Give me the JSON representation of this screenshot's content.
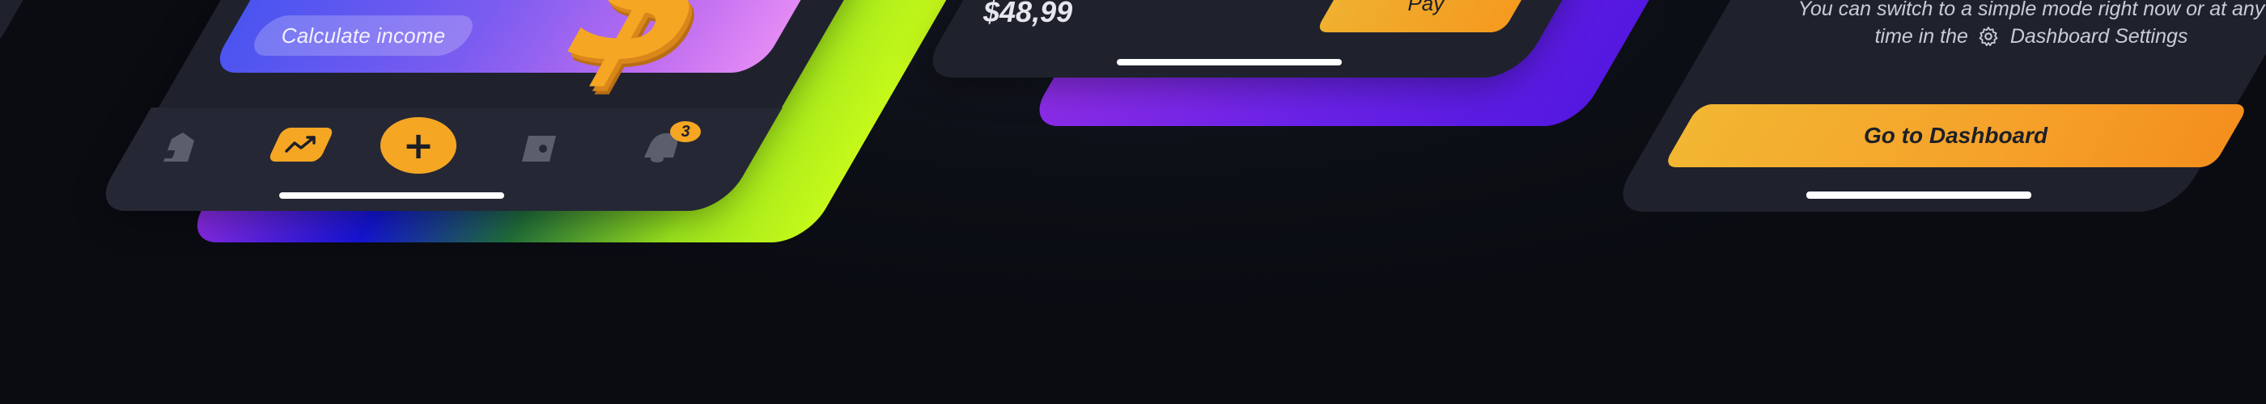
{
  "colors": {
    "background": "#0d0f16",
    "card": "#1f222d",
    "accent": "#f5a623",
    "purple": "#7b2be8",
    "lime": "#b6f01c"
  },
  "phone_income": {
    "banner_button_label": "Calculate income",
    "dollar_glyph": "$",
    "nav": {
      "items": [
        {
          "icon": "home-icon"
        },
        {
          "icon": "stats-icon"
        },
        {
          "icon": "add-icon",
          "glyph": "+"
        },
        {
          "icon": "wallet-icon"
        },
        {
          "icon": "notifications-icon",
          "badge": "3"
        }
      ]
    }
  },
  "phone_payment": {
    "price": "$48,99",
    "pay_label": "Pay"
  },
  "phone_onboarding": {
    "info_line1": "You can switch to a simple mode right now or at any",
    "info_prefix": "time in the",
    "info_link": "Dashboard Settings",
    "settings_icon": "gear-icon",
    "dashboard_button": "Go to Dashboard"
  }
}
